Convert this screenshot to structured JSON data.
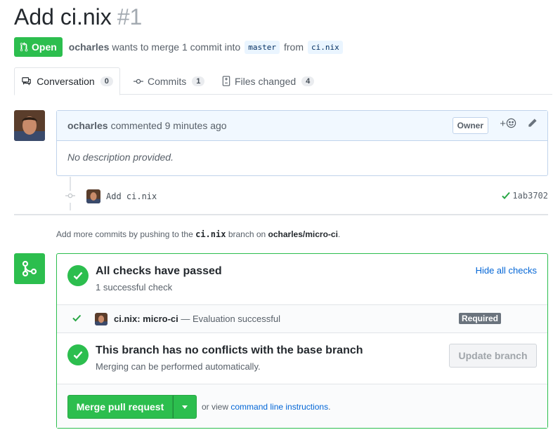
{
  "header": {
    "title": "Add ci.nix",
    "number": "#1",
    "state": "Open",
    "author": "ocharles",
    "summary": "wants to merge 1 commit into",
    "base_branch": "master",
    "from_word": "from",
    "head_branch": "ci.nix"
  },
  "tabs": [
    {
      "label": "Conversation",
      "count": "0",
      "icon": "comment-discussion-icon"
    },
    {
      "label": "Commits",
      "count": "1",
      "icon": "git-commit-icon"
    },
    {
      "label": "Files changed",
      "count": "4",
      "icon": "diff-icon"
    }
  ],
  "comment": {
    "author": "ocharles",
    "action": "commented 9 minutes ago",
    "badge": "Owner",
    "reaction_plus": "+",
    "body": "No description provided."
  },
  "commit": {
    "message": "Add ci.nix",
    "sha": "1ab3702"
  },
  "push_hint": {
    "prefix": "Add more commits by pushing to the",
    "branch": "ci.nix",
    "middle": "branch on",
    "repo": "ocharles/micro-ci",
    "suffix": "."
  },
  "checks": {
    "heading": "All checks have passed",
    "sub": "1 successful check",
    "toggle": "Hide all checks",
    "run_name": "ci.nix: micro-ci",
    "run_desc": "— Evaluation successful",
    "required": "Required"
  },
  "conflicts": {
    "heading": "This branch has no conflicts with the base branch",
    "sub": "Merging can be performed automatically.",
    "update_button": "Update branch"
  },
  "merge": {
    "button": "Merge pull request",
    "or_view": "or view",
    "link": "command line instructions",
    "suffix": "."
  },
  "colors": {
    "green": "#2cbe4e",
    "link": "#0366d6",
    "blue_header": "#f1f8ff"
  }
}
